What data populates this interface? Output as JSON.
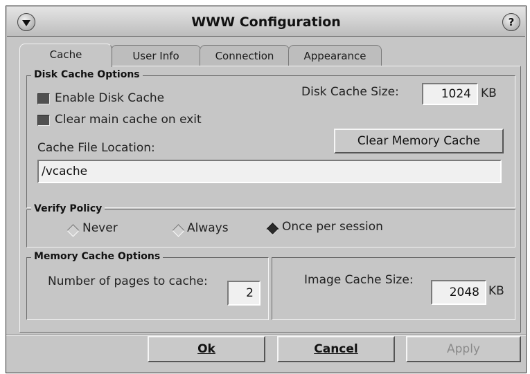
{
  "window": {
    "title": "WWW Configuration"
  },
  "tabs": [
    {
      "label": "Cache",
      "active": true
    },
    {
      "label": "User Info",
      "active": false
    },
    {
      "label": "Connection",
      "active": false
    },
    {
      "label": "Appearance",
      "active": false
    }
  ],
  "disk_cache": {
    "legend": "Disk Cache Options",
    "enable_label": "Enable Disk Cache",
    "enable_checked": true,
    "clear_on_exit_label": "Clear main cache on exit",
    "clear_on_exit_checked": true,
    "size_label": "Disk Cache Size:",
    "size_value": "1024",
    "size_unit": "KB",
    "clear_memory_button": "Clear Memory Cache",
    "location_label": "Cache File Location:",
    "location_value": "/vcache"
  },
  "verify_policy": {
    "legend": "Verify Policy",
    "options": [
      {
        "label": "Never",
        "selected": false
      },
      {
        "label": "Always",
        "selected": false
      },
      {
        "label": "Once per session",
        "selected": true
      }
    ]
  },
  "memory_cache": {
    "legend": "Memory Cache Options",
    "pages_label": "Number of pages to cache:",
    "pages_value": "2",
    "image_size_label": "Image Cache Size:",
    "image_size_value": "2048",
    "image_size_unit": "KB"
  },
  "buttons": {
    "ok": "Ok",
    "cancel": "Cancel",
    "apply": "Apply"
  }
}
